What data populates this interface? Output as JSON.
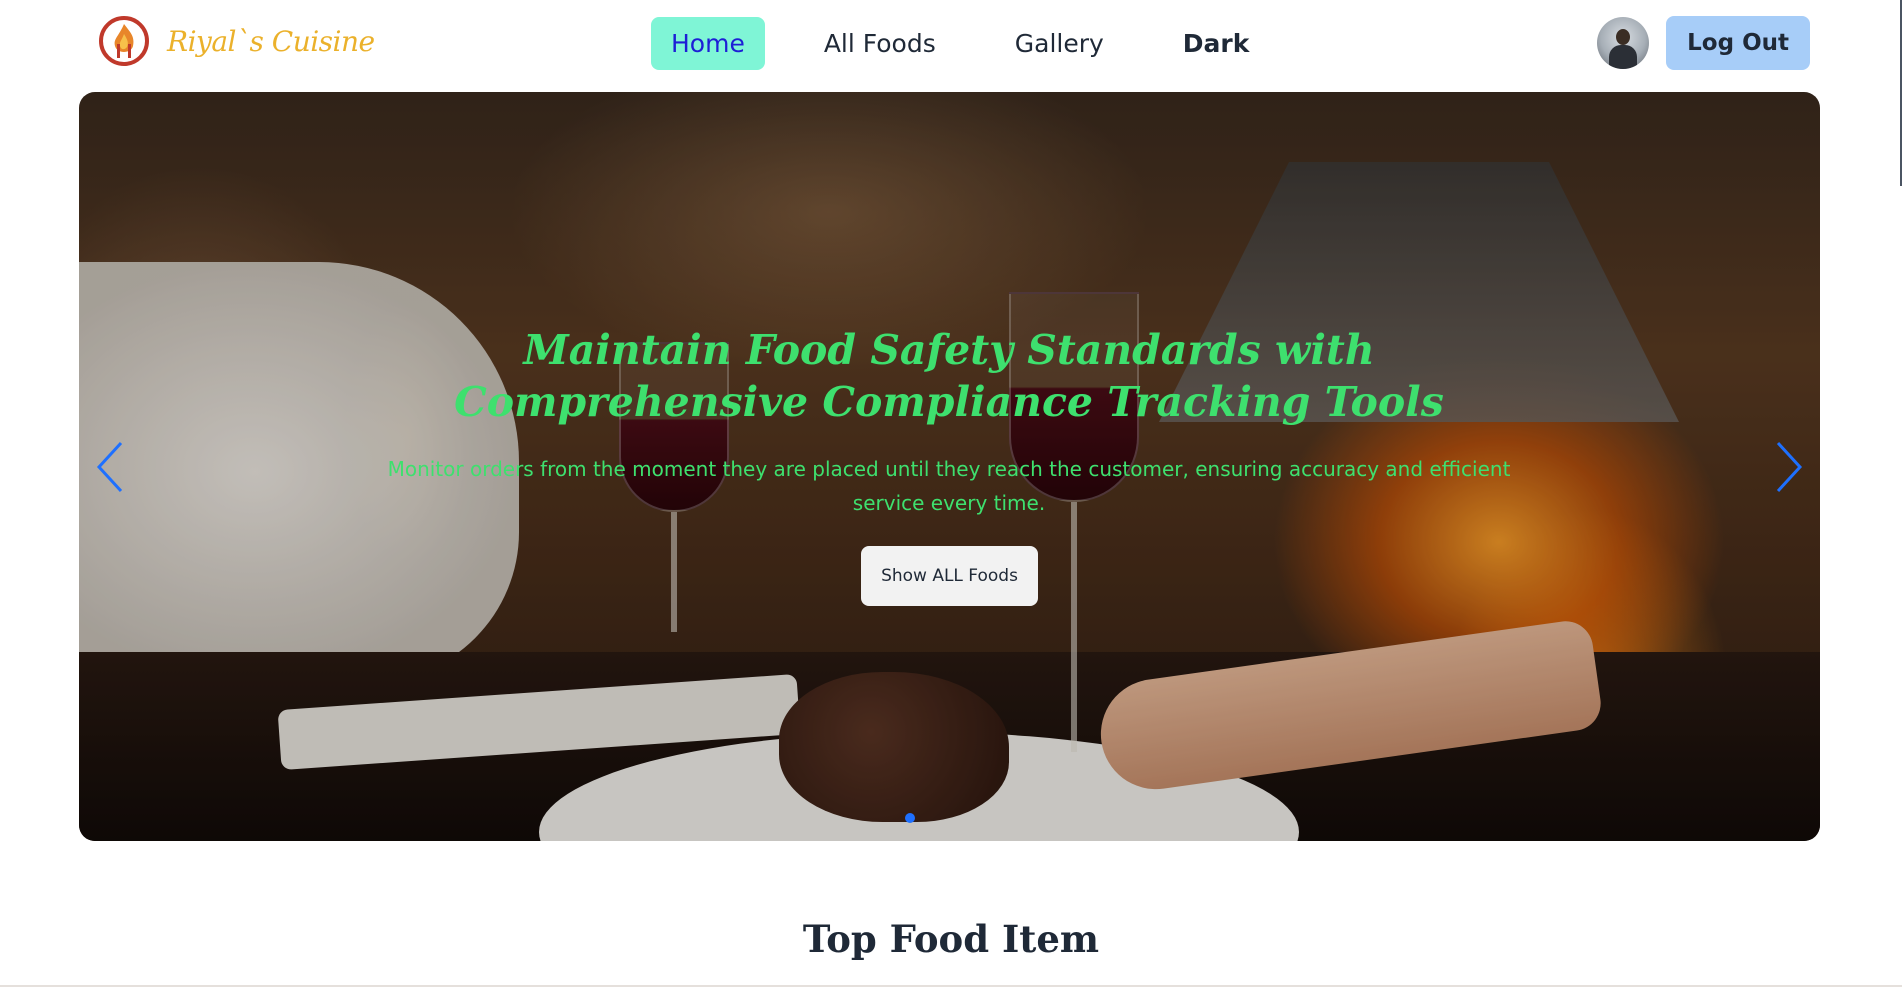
{
  "brand": {
    "name": "Riyal`s Cuisine",
    "logo_icon": "flame-fork-logo-icon",
    "color": "#ebb12b"
  },
  "nav": {
    "links": [
      {
        "label": "Home",
        "active": true
      },
      {
        "label": "All Foods",
        "active": false
      },
      {
        "label": "Gallery",
        "active": false
      },
      {
        "label": "Dark",
        "active": false
      }
    ],
    "active_bg": "#7ff5d6",
    "active_color": "#1d1fd6"
  },
  "user": {
    "avatar_icon": "user-avatar-icon",
    "logout_label": "Log Out",
    "logout_bg": "#a7cdf8"
  },
  "hero": {
    "title": "Maintain Food Safety Standards with Comprehensive Compliance Tracking Tools",
    "text": "Monitor orders from the moment they are placed until they reach the customer, ensuring accuracy and efficient service every time.",
    "button_label": "Show ALL Foods",
    "text_color": "#3ee06e",
    "prev_icon": "chevron-left-icon",
    "next_icon": "chevron-right-icon",
    "dot_color": "#1e70ff",
    "slide_indicator_count": 1
  },
  "section": {
    "title": "Top Food Item"
  }
}
